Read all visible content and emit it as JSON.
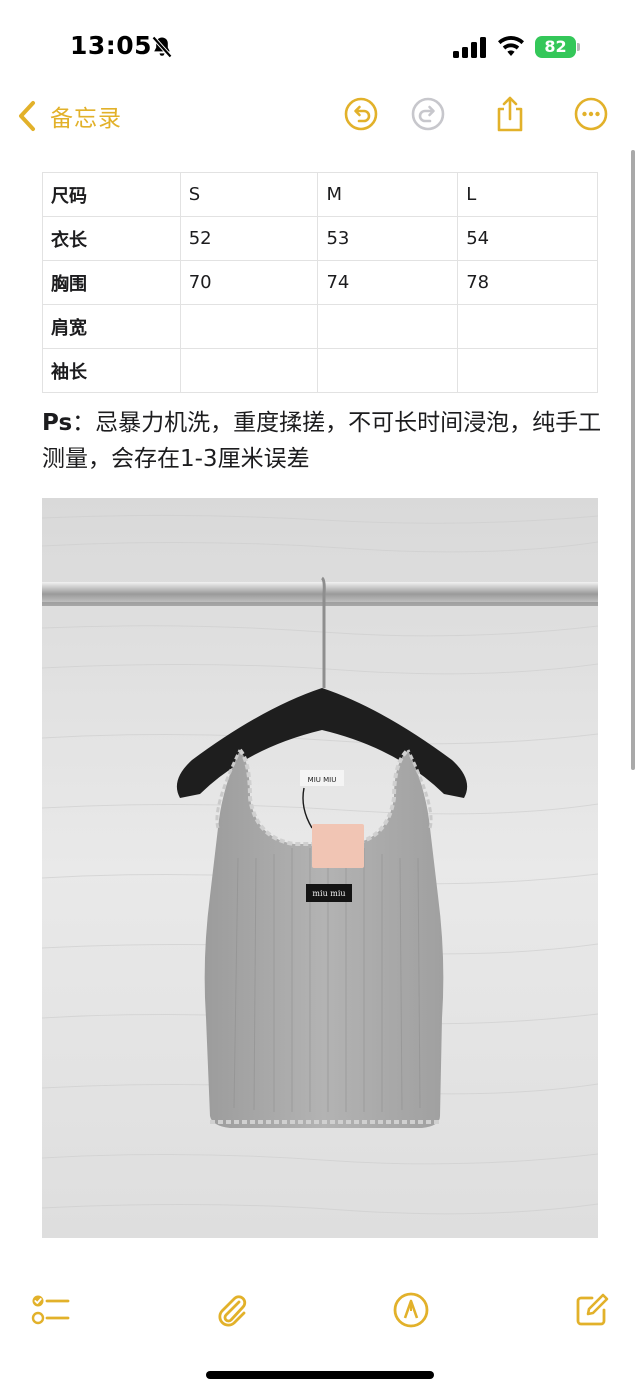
{
  "status_bar": {
    "time": "13:05",
    "silent_icon": "bell-slash-icon",
    "signal_icon": "cellular-signal-icon",
    "wifi_icon": "wifi-icon",
    "battery_level": "82",
    "battery_color": "#34c759"
  },
  "nav": {
    "back_label": "备忘录",
    "back_icon": "chevron-left-icon",
    "undo_icon": "undo-icon",
    "redo_icon": "redo-icon",
    "share_icon": "share-icon",
    "more_icon": "more-icon",
    "accent_color": "#e2b12a"
  },
  "table": {
    "rows": [
      [
        "尺码",
        "S",
        "M",
        "L"
      ],
      [
        "衣长",
        "52",
        "53",
        "54"
      ],
      [
        "胸围",
        "70",
        "74",
        "78"
      ],
      [
        "肩宽",
        "",
        "",
        ""
      ],
      [
        "袖长",
        "",
        "",
        ""
      ]
    ]
  },
  "note": {
    "ps_label": "Ps",
    "text": "：忌暴力机洗，重度揉搓，不可长时间浸泡，纯手工测量，会存在1-3厘米误差"
  },
  "photo": {
    "hanger_tag": "MIU MIU",
    "label_text": "miu miu"
  },
  "toolbar": {
    "checklist_icon": "checklist-icon",
    "attachment_icon": "paperclip-icon",
    "markup_icon": "pen-tip-icon",
    "compose_icon": "compose-icon"
  }
}
